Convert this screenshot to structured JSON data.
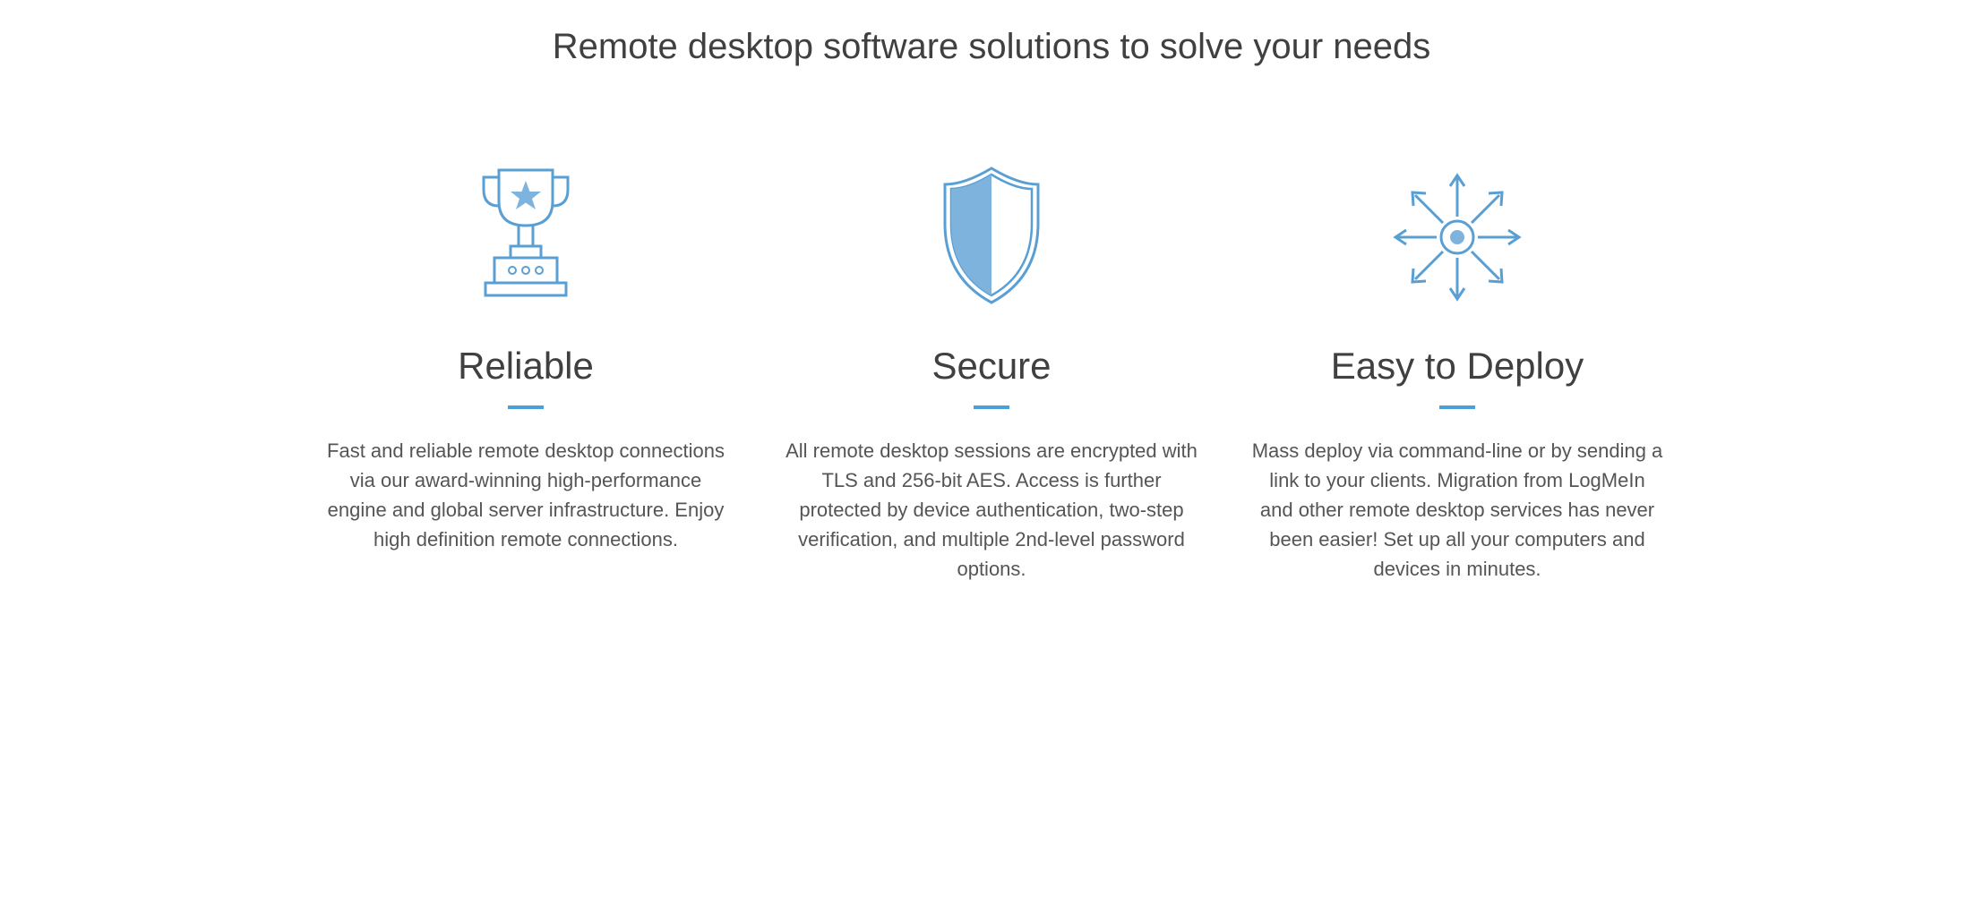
{
  "heading": "Remote desktop software solutions to solve your needs",
  "features": [
    {
      "title": "Reliable",
      "desc": "Fast and reliable remote desktop connections via our award-winning high-performance engine and global server infrastructure. Enjoy high definition remote connections."
    },
    {
      "title": "Secure",
      "desc": "All remote desktop sessions are encrypted with TLS and 256-bit AES. Access is further protected by device authentication, two-step verification, and multiple 2nd-level password options."
    },
    {
      "title": "Easy to Deploy",
      "desc": "Mass deploy via command-line or by sending a link to your clients. Migration from LogMeIn and other remote desktop services has never been easier! Set up all your computers and devices in minutes."
    }
  ],
  "colors": {
    "accent": "#5a9fd4",
    "accentFill": "#7eb3de"
  }
}
